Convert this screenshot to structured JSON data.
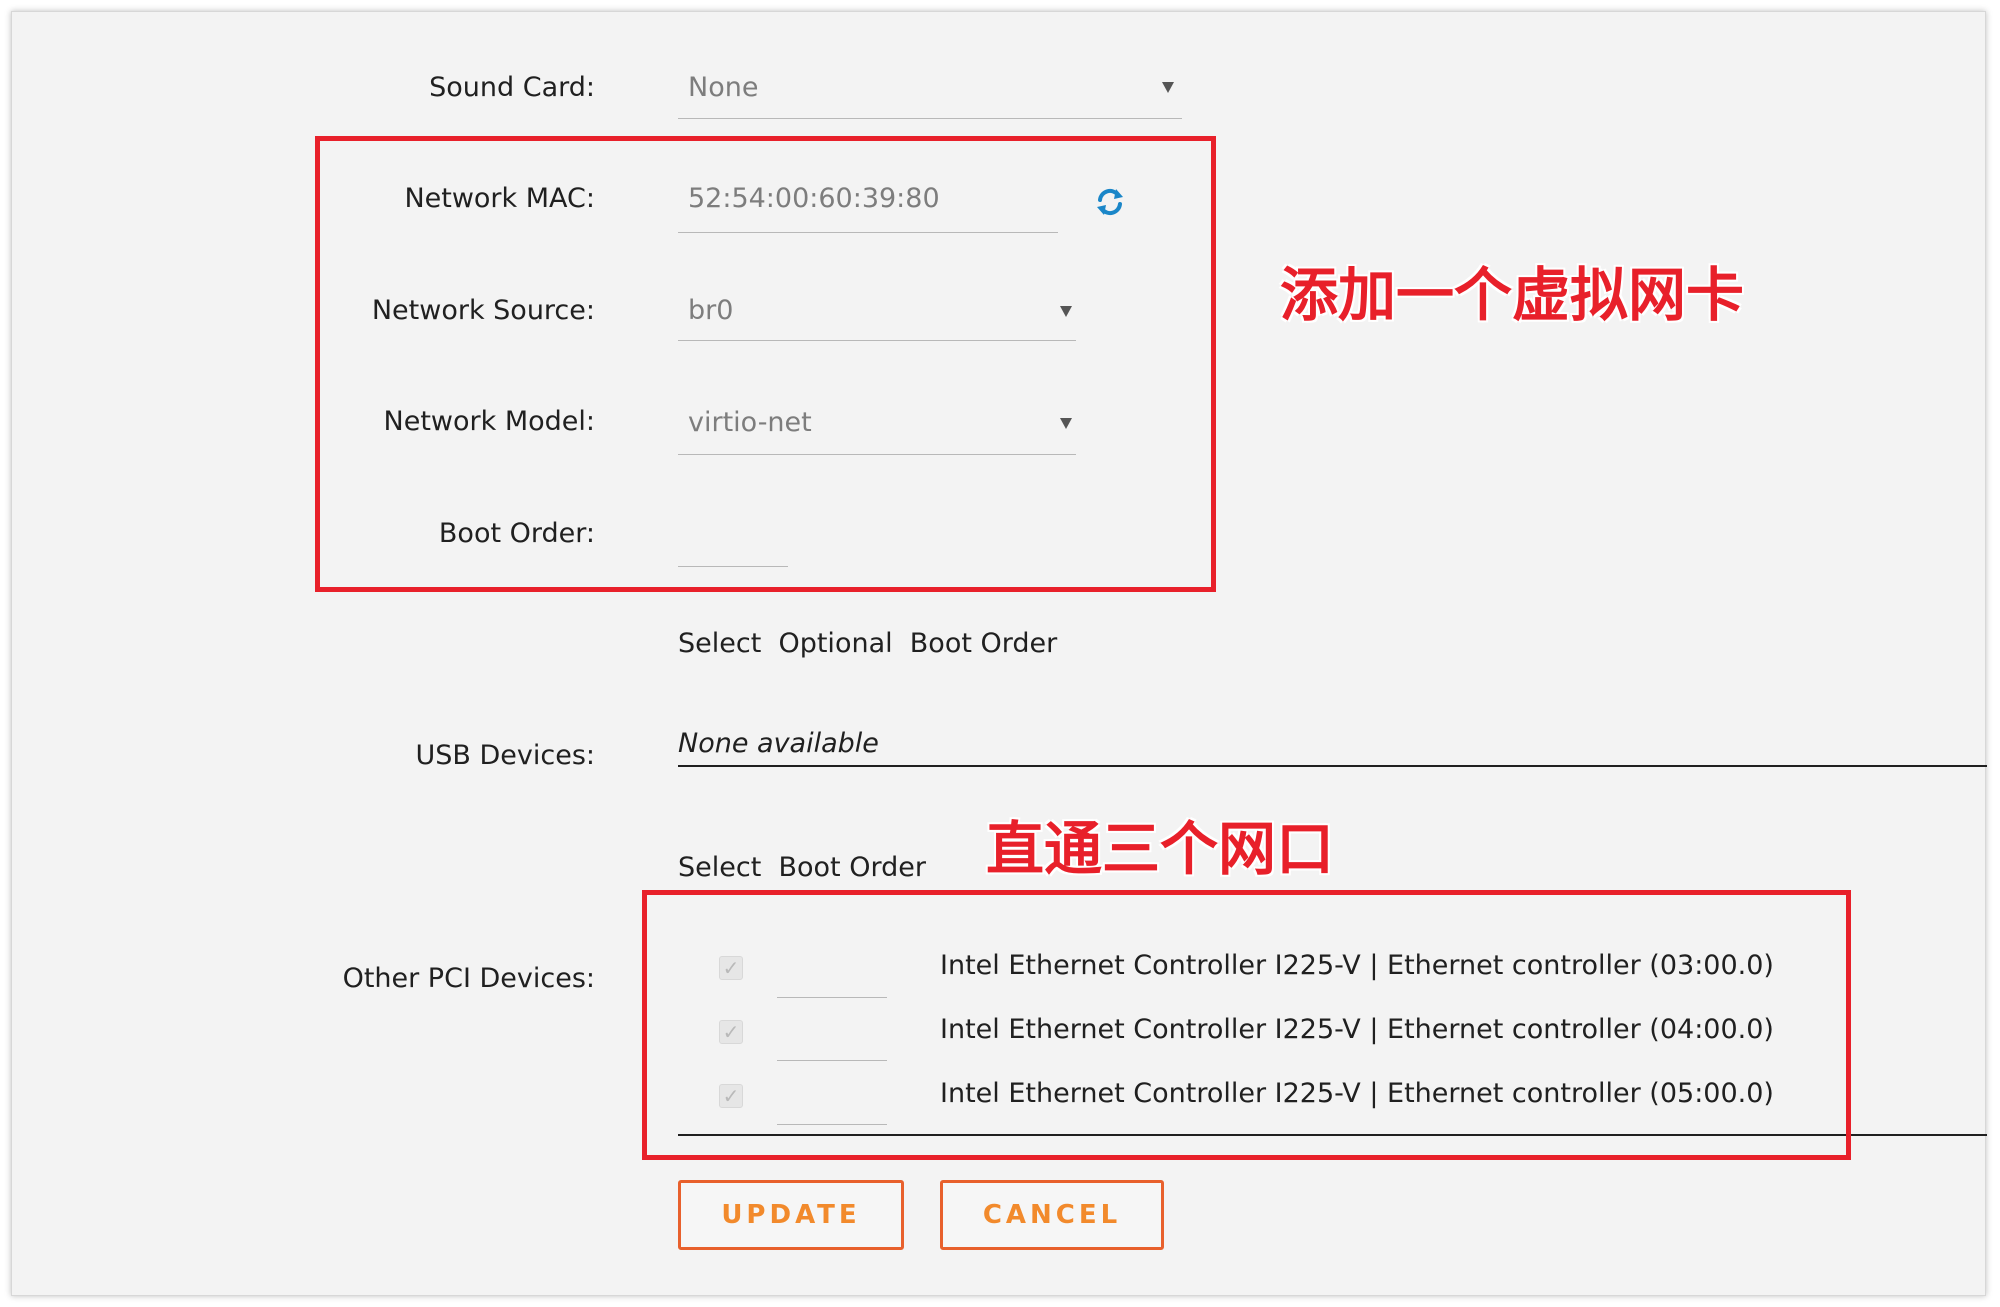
{
  "form": {
    "sound_card": {
      "label": "Sound Card:",
      "value": "None"
    },
    "network_mac": {
      "label": "Network MAC:",
      "value": "52:54:00:60:39:80",
      "refresh_icon": "refresh-icon"
    },
    "network_source": {
      "label": "Network Source:",
      "value": "br0"
    },
    "network_model": {
      "label": "Network Model:",
      "value": "virtio-net"
    },
    "boot_order": {
      "label": "Boot Order:",
      "value": ""
    },
    "boot_hint": "Select  Optional  Boot Order",
    "usb_devices": {
      "label": "USB Devices:",
      "value": "None available"
    },
    "pci_header": "Select  Boot Order",
    "pci": {
      "label": "Other PCI Devices:",
      "devices": [
        {
          "name": "Intel Ethernet Controller I225-V | Ethernet controller (03:00.0)",
          "checked": true
        },
        {
          "name": "Intel Ethernet Controller I225-V | Ethernet controller (04:00.0)",
          "checked": true
        },
        {
          "name": "Intel Ethernet Controller I225-V | Ethernet controller (05:00.0)",
          "checked": true
        }
      ]
    },
    "buttons": {
      "update": "UPDATE",
      "cancel": "CANCEL"
    }
  },
  "annotations": {
    "virtual_nic": "添加一个虚拟网卡",
    "passthrough": "直通三个网口",
    "color": "#e8202a"
  }
}
